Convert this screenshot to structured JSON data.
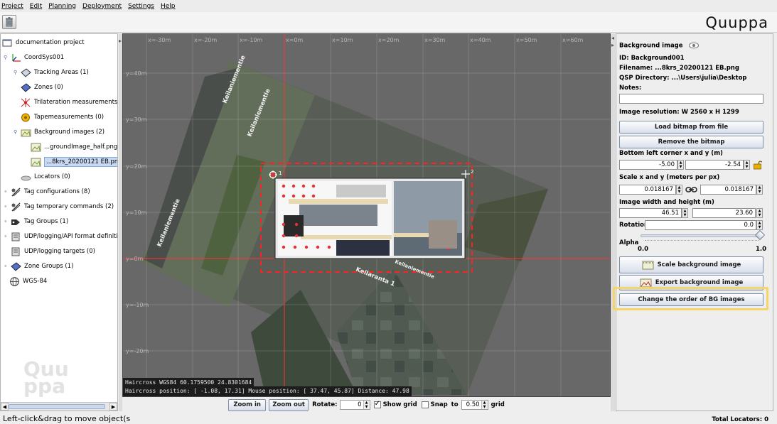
{
  "menu": [
    "Project",
    "Edit",
    "Planning",
    "Deployment",
    "Settings",
    "Help"
  ],
  "logo": "Quuppa",
  "tree": {
    "items": [
      {
        "label": "documentation project",
        "icon": "project-icon"
      },
      {
        "label": "CoordSys001",
        "icon": "coordinate-system-icon"
      },
      {
        "label": "Tracking Areas (1)",
        "icon": "tracking-area-icon"
      },
      {
        "label": "Zones (0)",
        "icon": "zone-icon"
      },
      {
        "label": "Trilateration measurements (0",
        "icon": "trilateration-icon"
      },
      {
        "label": "Tapemeasurements (0)",
        "icon": "tape-measure-icon"
      },
      {
        "label": "Background images (2)",
        "icon": "folder-images-icon"
      },
      {
        "label": "...groundImage_half.png",
        "icon": "image-file-icon"
      },
      {
        "label": "...8krs_20200121 EB.png",
        "icon": "image-file-icon"
      },
      {
        "label": "Locators (0)",
        "icon": "locator-icon"
      },
      {
        "label": "Tag configurations (8)",
        "icon": "tag-config-icon"
      },
      {
        "label": "Tag temporary commands (2)",
        "icon": "tag-command-icon"
      },
      {
        "label": "Tag Groups (1)",
        "icon": "tag-group-icon"
      },
      {
        "label": "UDP/logging/API format definitions (",
        "icon": "udp-format-icon"
      },
      {
        "label": "UDP/logging targets (0)",
        "icon": "udp-target-icon"
      },
      {
        "label": "Zone Groups (1)",
        "icon": "zone-group-icon"
      },
      {
        "label": "WGS-84",
        "icon": "globe-icon"
      }
    ],
    "watermark": "Quu ppa"
  },
  "canvas": {
    "x_ticks": [
      "x=-30m",
      "x=-20m",
      "x=-10m",
      "x=0m",
      "x=10m",
      "x=20m",
      "x=30m",
      "x=40m",
      "x=50m",
      "x=60m"
    ],
    "y_ticks": [
      "y=40m",
      "y=30m",
      "y=20m",
      "y=10m",
      "y=0m",
      "y=-10m",
      "y=-20m"
    ],
    "street_labels": [
      "Keilaniementie",
      "Keilaniementie",
      "Keilaniementie",
      "Keilaniementie",
      "Keilaranta 1"
    ],
    "corner_markers": [
      "1",
      "2"
    ],
    "readout_wgs": "Haircross WGS84 60.1759500 24.8301684",
    "readout_position": "Haircross position: [    -1.08,    17.31]   Mouse position: [    37.47,    45.87]   Distance: 47.98",
    "colors": {
      "grid": "#ff3333",
      "selection": "#ff2222"
    }
  },
  "canvas_bar": {
    "zoom_in": "Zoom in",
    "zoom_out": "Zoom out",
    "rotate_label": "Rotate:",
    "rotate_value": "0",
    "show_grid": "Show grid",
    "snap": "Snap",
    "to": "to",
    "snap_value": "0.50",
    "grid": "grid"
  },
  "props": {
    "title": "Background image",
    "id": "ID: Background001",
    "filename": "Filename:  ...8krs_20200121 EB.png",
    "qsp_dir": "QSP Directory:  ...\\Users\\julia\\Desktop",
    "notes_label": "Notes:",
    "notes_value": "",
    "resolution": "Image resolution:  W 2560 x H 1299",
    "load_button": "Load bitmap from file",
    "remove_button": "Remove the bitmap",
    "corner_label": "Bottom left corner x and y (m)",
    "corner_x": "-5.00",
    "corner_y": "-2.54",
    "scale_label": "Scale x and y (meters per px)",
    "scale_x": "0.018167",
    "scale_y": "0.018167",
    "size_label": "Image width and height (m)",
    "width": "46.51",
    "height": "23.60",
    "rotation_label": "Rotation",
    "rotation_value": "0.0",
    "alpha_label": "Alpha",
    "alpha_min": "0.0",
    "alpha_max": "1.0",
    "alpha_value": 1.0,
    "scale_button": "Scale background image",
    "export_button": "Export background image",
    "order_button": "Change the order of BG images"
  },
  "status": {
    "hint": "Left-click&drag to move object(s",
    "total_locators": "Total Locators: 0"
  }
}
